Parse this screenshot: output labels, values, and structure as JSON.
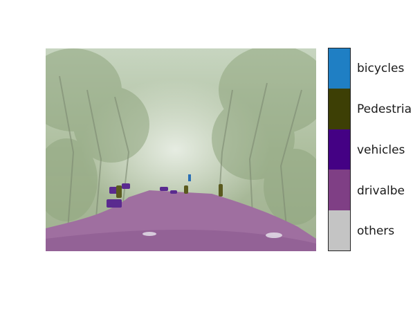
{
  "figure": {
    "image_content": "Forest road with semantic segmentation overlay",
    "legend": {
      "colors": {
        "bicycles": "#1f7fc4",
        "pedestrians": "#3d3f05",
        "vehicles": "#440184",
        "drivable": "#7f3f85",
        "others": "#c4c4c4"
      },
      "entries": [
        {
          "label": "bicycles",
          "color": "#1f7fc4"
        },
        {
          "label": "Pedestria",
          "color": "#3d3f05"
        },
        {
          "label": "vehicles",
          "color": "#440184"
        },
        {
          "label": "drivalbe",
          "color": "#7f3f85"
        },
        {
          "label": "others",
          "color": "#c4c4c4"
        }
      ]
    }
  }
}
